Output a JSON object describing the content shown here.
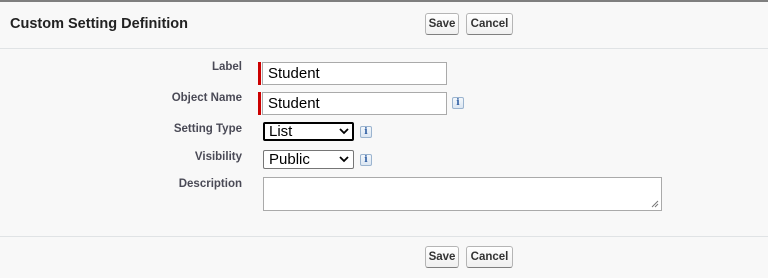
{
  "header": {
    "title": "Custom Setting Definition"
  },
  "buttons": {
    "save": "Save",
    "cancel": "Cancel"
  },
  "fields": {
    "label": {
      "label": "Label",
      "value": "Student"
    },
    "object_name": {
      "label": "Object Name",
      "value": "Student"
    },
    "setting_type": {
      "label": "Setting Type",
      "value": "List"
    },
    "visibility": {
      "label": "Visibility",
      "value": "Public"
    },
    "description": {
      "label": "Description",
      "value": ""
    }
  },
  "icons": {
    "info": "i"
  },
  "colors": {
    "required_bar": "#cc0000",
    "page_bg": "#f8f8f8"
  }
}
